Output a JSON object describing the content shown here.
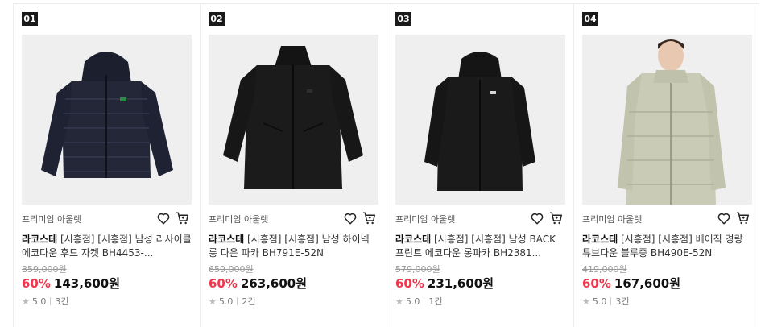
{
  "products": [
    {
      "rank": "01",
      "store": "프리미엄 아울렛",
      "brand": "라코스테",
      "name": "[시흥점] [시흥점] 남성 리사이클 에코다운 후드 자켓 BH4453-...",
      "original_price": "359,000원",
      "discount": "60%",
      "sale_price": "143,600원",
      "rating": "5.0",
      "reviews": "3건",
      "image": "navy hooded puffer jacket"
    },
    {
      "rank": "02",
      "store": "프리미엄 아울렛",
      "brand": "라코스테",
      "name": "[시흥점] [시흥점] 남성 하이넥 롱 다운 파카 BH791E-52N",
      "original_price": "659,000원",
      "discount": "60%",
      "sale_price": "263,600원",
      "rating": "5.0",
      "reviews": "2건",
      "image": "black long down parka"
    },
    {
      "rank": "03",
      "store": "프리미엄 아울렛",
      "brand": "라코스테",
      "name": "[시흥점] [시흥점] 남성 BACK 프린트 에코다운 롱파카 BH2381...",
      "original_price": "579,000원",
      "discount": "60%",
      "sale_price": "231,600원",
      "rating": "5.0",
      "reviews": "1건",
      "image": "black hooded long parka"
    },
    {
      "rank": "04",
      "store": "프리미엄 아울렛",
      "brand": "라코스테",
      "name": "[시흥점] [시흥점] 베이직 경량 튜브다운 블루종 BH490E-52N",
      "original_price": "419,000원",
      "discount": "60%",
      "sale_price": "167,600원",
      "rating": "5.0",
      "reviews": "3건",
      "image": "beige light tube down blouson"
    }
  ],
  "colors": {
    "discount": "#f0364f",
    "rank_badge": "#1a1a1a",
    "thumb_bg": "#efefef"
  },
  "icons": [
    "heart-icon",
    "cart-icon",
    "star-icon"
  ]
}
